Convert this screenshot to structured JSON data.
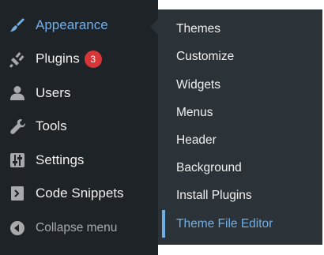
{
  "sidebar": {
    "items": [
      {
        "label": "Appearance",
        "icon": "paintbrush-icon",
        "current": true
      },
      {
        "label": "Plugins",
        "icon": "plug-icon",
        "badge": "3"
      },
      {
        "label": "Users",
        "icon": "user-icon"
      },
      {
        "label": "Tools",
        "icon": "wrench-icon"
      },
      {
        "label": "Settings",
        "icon": "sliders-icon"
      },
      {
        "label": "Code Snippets",
        "icon": "code-icon"
      }
    ],
    "collapse_label": "Collapse menu",
    "collapse_icon": "collapse-arrow-icon"
  },
  "submenu": {
    "items": [
      {
        "label": "Themes"
      },
      {
        "label": "Customize"
      },
      {
        "label": "Widgets"
      },
      {
        "label": "Menus"
      },
      {
        "label": "Header"
      },
      {
        "label": "Background"
      },
      {
        "label": "Install Plugins"
      },
      {
        "label": "Theme File Editor",
        "active": true
      }
    ]
  },
  "colors": {
    "sidebar_bg": "#1d2327",
    "submenu_bg": "#2c3338",
    "accent": "#72aee6",
    "badge": "#d63638",
    "text": "#f0f0f1",
    "muted_text": "#a7aaad",
    "icon": "#a7aaad"
  }
}
